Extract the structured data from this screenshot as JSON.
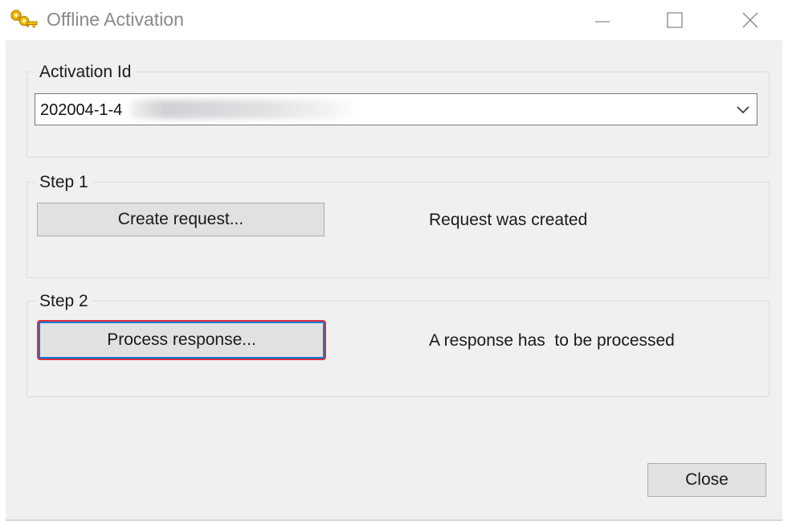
{
  "window": {
    "title": "Offline Activation",
    "icon": "keys-icon",
    "controls": [
      "minimize-icon",
      "maximize-icon",
      "close-icon"
    ]
  },
  "activation": {
    "group_label": "Activation Id",
    "id_value_visible": "202004-1-4",
    "id_value_obscured": true
  },
  "step1": {
    "group_label": "Step 1",
    "button_label": "Create request...",
    "status": "Request was created"
  },
  "step2": {
    "group_label": "Step 2",
    "button_label": "Process response...",
    "status": "A response has  to be processed",
    "button_focused": true
  },
  "footer": {
    "close_label": "Close"
  },
  "colors": {
    "focus_blue": "#0078d7",
    "highlight_red": "#e0303a",
    "dialog_bg": "#f0f0f0",
    "button_bg": "#e1e1e1"
  }
}
